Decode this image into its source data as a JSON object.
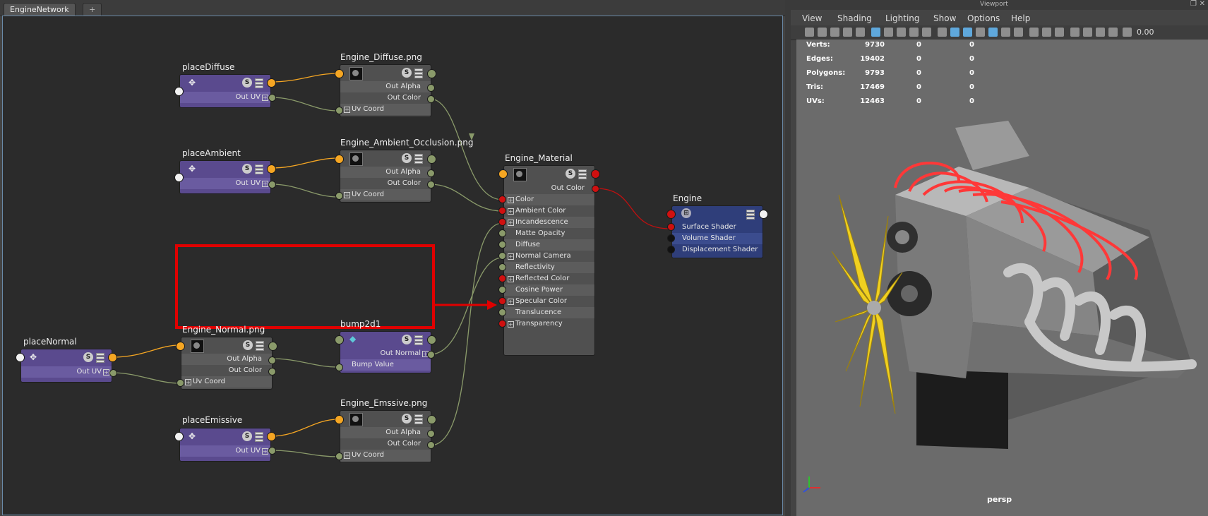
{
  "tabs": {
    "active": "EngineNetwork",
    "add": "+"
  },
  "viewport": {
    "header": "Viewport",
    "menu": [
      "View",
      "Shading",
      "Lighting",
      "Show",
      "Options",
      "Help"
    ],
    "zoom": "0.00",
    "camera": "persp",
    "stats": [
      {
        "label": "Verts:",
        "v1": "9730",
        "v2": "0",
        "v3": "0"
      },
      {
        "label": "Edges:",
        "v1": "19402",
        "v2": "0",
        "v3": "0"
      },
      {
        "label": "Polygons:",
        "v1": "9793",
        "v2": "0",
        "v3": "0"
      },
      {
        "label": "Tris:",
        "v1": "17469",
        "v2": "0",
        "v3": "0"
      },
      {
        "label": "UVs:",
        "v1": "12463",
        "v2": "0",
        "v3": "0"
      }
    ]
  },
  "nodes": {
    "placeDiffuse": {
      "title": "placeDiffuse",
      "out": "Out UV"
    },
    "placeAmbient": {
      "title": "placeAmbient",
      "out": "Out UV"
    },
    "placeNormal": {
      "title": "placeNormal",
      "out": "Out UV"
    },
    "placeEmissive": {
      "title": "placeEmissive",
      "out": "Out UV"
    },
    "diffuse": {
      "title": "Engine_Diffuse.png",
      "alpha": "Out Alpha",
      "color": "Out Color",
      "uv": "Uv Coord"
    },
    "ambient": {
      "title": "Engine_Ambient_Occlusion.png",
      "alpha": "Out Alpha",
      "color": "Out Color",
      "uv": "Uv Coord"
    },
    "normal": {
      "title": "Engine_Normal.png",
      "alpha": "Out Alpha",
      "color": "Out Color",
      "uv": "Uv Coord"
    },
    "emissive": {
      "title": "Engine_Emssive.png",
      "alpha": "Out Alpha",
      "color": "Out Color",
      "uv": "Uv Coord"
    },
    "bump": {
      "title": "bump2d1",
      "out": "Out Normal",
      "in": "Bump Value"
    },
    "material": {
      "title": "Engine_Material",
      "out": "Out Color",
      "attrs": [
        "Color",
        "Ambient Color",
        "Incandescence",
        "Matte Opacity",
        "Diffuse",
        "Normal Camera",
        "Reflectivity",
        "Reflected Color",
        "Cosine Power",
        "Specular Color",
        "Translucence",
        "Transparency"
      ]
    },
    "engine": {
      "title": "Engine",
      "attrs": [
        "Surface Shader",
        "Volume Shader",
        "Displacement Shader"
      ]
    }
  },
  "colors": {
    "wire_yellow": "#f5a623",
    "wire_green": "#8a9a6a",
    "wire_red": "#c01010",
    "callout": "#e00000"
  }
}
